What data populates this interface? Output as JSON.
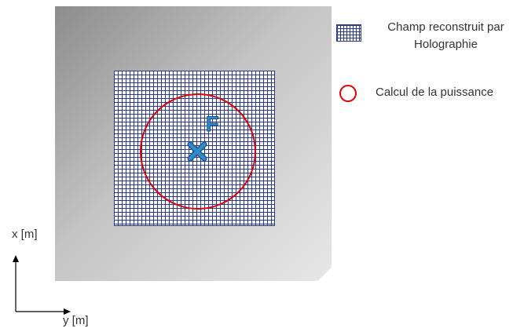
{
  "legend": {
    "grid_label_line1": "Champ reconstruit par",
    "grid_label_line2": "Holographie",
    "circle_label": "Calcul de la puissance"
  },
  "diagram": {
    "focus_label": "F"
  },
  "axes": {
    "vertical_label": "x [m]",
    "horizontal_label": "y [m]"
  },
  "colors": {
    "grid": "#2a3b8f",
    "circle": "#e00000",
    "focus_marker": "#2e8bd0"
  },
  "icons": {
    "focus_marker": "cross-icon",
    "axes": "axis-arrows-icon"
  }
}
